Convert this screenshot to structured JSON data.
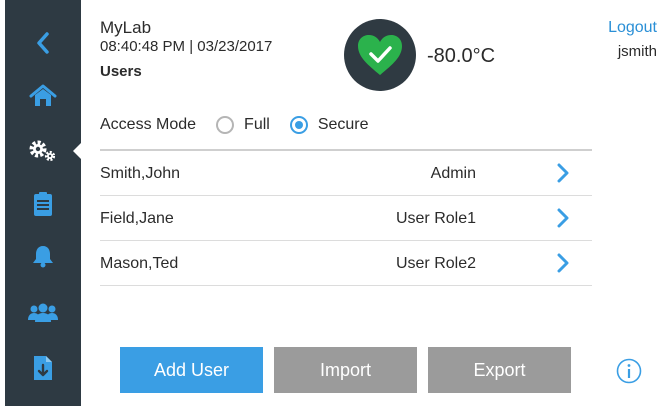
{
  "header": {
    "app_name": "MyLab",
    "datetime": "08:40:48 PM | 03/23/2017",
    "section_title": "Users",
    "temperature": "-80.0°C",
    "logout_label": "Logout",
    "username": "jsmith"
  },
  "status": {
    "state": "ok",
    "icon": "check-heart-icon",
    "color": "#2bb24c"
  },
  "sidebar": {
    "items": [
      {
        "name": "back",
        "icon": "chevron-left-icon"
      },
      {
        "name": "home",
        "icon": "home-icon"
      },
      {
        "name": "settings",
        "icon": "gears-icon",
        "active": true
      },
      {
        "name": "notes",
        "icon": "clipboard-icon"
      },
      {
        "name": "alerts",
        "icon": "bell-icon"
      },
      {
        "name": "users",
        "icon": "users-icon"
      },
      {
        "name": "file",
        "icon": "file-download-icon"
      }
    ]
  },
  "access_mode": {
    "label": "Access Mode",
    "options": [
      "Full",
      "Secure"
    ],
    "selected": "Secure"
  },
  "users": [
    {
      "name": "Smith,John",
      "role": "Admin"
    },
    {
      "name": "Field,Jane",
      "role": "User Role1"
    },
    {
      "name": "Mason,Ted",
      "role": "User Role2"
    }
  ],
  "buttons": {
    "add_user": "Add User",
    "import": "Import",
    "export": "Export"
  },
  "colors": {
    "accent": "#3a9ee4",
    "sidebar_bg": "#2e3a43",
    "disabled_button": "#9b9b9b",
    "link": "#2a8fd6"
  }
}
